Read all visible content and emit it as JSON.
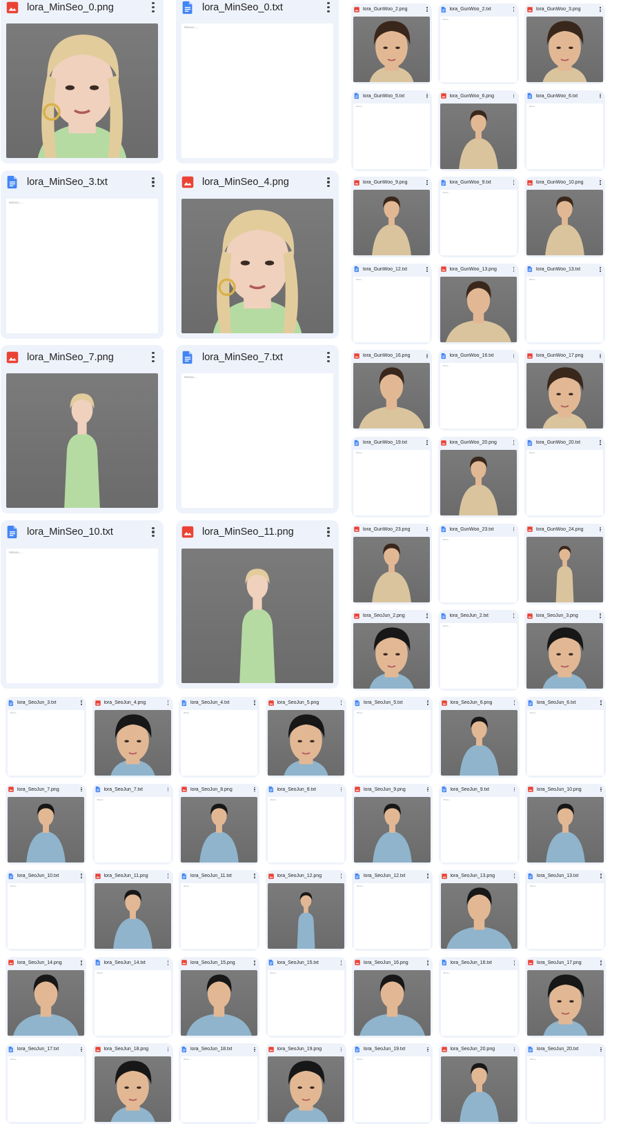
{
  "colors": {
    "image_icon": "#ea4335",
    "doc_icon": "#4285f4",
    "card_bg": "#eef2fa"
  },
  "icons": {
    "image": "image-file-icon",
    "doc": "doc-file-icon",
    "menu": "more-vert-icon"
  },
  "menu_label": "More actions",
  "doc_preview": "Minseo, ...",
  "files_large": [
    {
      "name": "lora_MinSeo_0.png",
      "type": "image",
      "subject": "woman",
      "bg": "gray",
      "crop": "head"
    },
    {
      "name": "lora_MinSeo_0.txt",
      "type": "text"
    },
    {
      "name": "lora_MinSeo_3.txt",
      "type": "text"
    },
    {
      "name": "lora_MinSeo_4.png",
      "type": "image",
      "subject": "woman",
      "bg": "gray",
      "crop": "head"
    },
    {
      "name": "lora_MinSeo_7.png",
      "type": "image",
      "subject": "woman",
      "bg": "gray",
      "crop": "body"
    },
    {
      "name": "lora_MinSeo_7.txt",
      "type": "text"
    },
    {
      "name": "lora_MinSeo_10.txt",
      "type": "text"
    },
    {
      "name": "lora_MinSeo_11.png",
      "type": "image",
      "subject": "woman",
      "bg": "gray",
      "crop": "body"
    }
  ],
  "files_right": [
    {
      "name": "lora_GunWoo_2.png",
      "type": "image",
      "subject": "gunwoo",
      "bg": "gray",
      "crop": "head"
    },
    {
      "name": "lora_GunWoo_2.txt",
      "type": "text"
    },
    {
      "name": "lora_GunWoo_3.png",
      "type": "image",
      "subject": "gunwoo",
      "bg": "gray",
      "crop": "head"
    },
    {
      "name": "lora_GunWoo_5.txt",
      "type": "text"
    },
    {
      "name": "lora_GunWoo_6.png",
      "type": "image",
      "subject": "gunwoo",
      "bg": "gray",
      "crop": "torso"
    },
    {
      "name": "lora_GunWoo_6.txt",
      "type": "text"
    },
    {
      "name": "lora_GunWoo_9.png",
      "type": "image",
      "subject": "gunwoo",
      "bg": "gray",
      "crop": "torso"
    },
    {
      "name": "lora_GunWoo_9.txt",
      "type": "text"
    },
    {
      "name": "lora_GunWoo_10.png",
      "type": "image",
      "subject": "gunwoo",
      "bg": "gray",
      "crop": "torso"
    },
    {
      "name": "lora_GunWoo_12.txt",
      "type": "text"
    },
    {
      "name": "lora_GunWoo_13.png",
      "type": "image",
      "subject": "gunwoo",
      "bg": "gray",
      "crop": "bust"
    },
    {
      "name": "lora_GunWoo_13.txt",
      "type": "text"
    },
    {
      "name": "lora_GunWoo_16.png",
      "type": "image",
      "subject": "gunwoo",
      "bg": "gray",
      "crop": "bust"
    },
    {
      "name": "lora_GunWoo_16.txt",
      "type": "text"
    },
    {
      "name": "lora_GunWoo_17.png",
      "type": "image",
      "subject": "gunwoo",
      "bg": "red",
      "crop": "head"
    },
    {
      "name": "lora_GunWoo_19.txt",
      "type": "text"
    },
    {
      "name": "lora_GunWoo_20.png",
      "type": "image",
      "subject": "gunwoo",
      "bg": "red",
      "crop": "torso"
    },
    {
      "name": "lora_GunWoo_20.txt",
      "type": "text"
    },
    {
      "name": "lora_GunWoo_23.png",
      "type": "image",
      "subject": "gunwoo",
      "bg": "red",
      "crop": "torso"
    },
    {
      "name": "lora_GunWoo_23.txt",
      "type": "text"
    },
    {
      "name": "lora_GunWoo_24.png",
      "type": "image",
      "subject": "gunwoo",
      "bg": "red",
      "crop": "full"
    },
    {
      "name": "lora_SeoJun_2.png",
      "type": "image",
      "subject": "seojun",
      "bg": "gray",
      "crop": "head"
    },
    {
      "name": "lora_SeoJun_2.txt",
      "type": "text"
    },
    {
      "name": "lora_SeoJun_3.png",
      "type": "image",
      "subject": "seojun",
      "bg": "gray",
      "crop": "head"
    }
  ],
  "files_bottom": [
    {
      "name": "lora_SeoJun_3.txt",
      "type": "text"
    },
    {
      "name": "lora_SeoJun_4.png",
      "type": "image",
      "subject": "seojun",
      "bg": "gray",
      "crop": "head"
    },
    {
      "name": "lora_SeoJun_4.txt",
      "type": "text"
    },
    {
      "name": "lora_SeoJun_5.png",
      "type": "image",
      "subject": "seojun",
      "bg": "gray",
      "crop": "head"
    },
    {
      "name": "lora_SeoJun_5.txt",
      "type": "text"
    },
    {
      "name": "lora_SeoJun_6.png",
      "type": "image",
      "subject": "seojun",
      "bg": "gray",
      "crop": "torso"
    },
    {
      "name": "lora_SeoJun_6.txt",
      "type": "text"
    },
    {
      "name": "lora_SeoJun_7.png",
      "type": "image",
      "subject": "seojun",
      "bg": "gray",
      "crop": "torso"
    },
    {
      "name": "lora_SeoJun_7.txt",
      "type": "text"
    },
    {
      "name": "lora_SeoJun_8.png",
      "type": "image",
      "subject": "seojun",
      "bg": "gray",
      "crop": "torso"
    },
    {
      "name": "lora_SeoJun_8.txt",
      "type": "text"
    },
    {
      "name": "lora_SeoJun_9.png",
      "type": "image",
      "subject": "seojun",
      "bg": "gray",
      "crop": "torso"
    },
    {
      "name": "lora_SeoJun_9.txt",
      "type": "text"
    },
    {
      "name": "lora_SeoJun_10.png",
      "type": "image",
      "subject": "seojun",
      "bg": "gray",
      "crop": "torso"
    },
    {
      "name": "lora_SeoJun_10.txt",
      "type": "text"
    },
    {
      "name": "lora_SeoJun_11.png",
      "type": "image",
      "subject": "seojun",
      "bg": "gray",
      "crop": "torso"
    },
    {
      "name": "lora_SeoJun_11.txt",
      "type": "text"
    },
    {
      "name": "lora_SeoJun_12.png",
      "type": "image",
      "subject": "seojun",
      "bg": "gray",
      "crop": "full"
    },
    {
      "name": "lora_SeoJun_12.txt",
      "type": "text"
    },
    {
      "name": "lora_SeoJun_13.png",
      "type": "image",
      "subject": "seojun",
      "bg": "gray",
      "crop": "bust"
    },
    {
      "name": "lora_SeoJun_13.txt",
      "type": "text"
    },
    {
      "name": "lora_SeoJun_14.png",
      "type": "image",
      "subject": "seojun",
      "bg": "gray",
      "crop": "bust"
    },
    {
      "name": "lora_SeoJun_14.txt",
      "type": "text"
    },
    {
      "name": "lora_SeoJun_15.png",
      "type": "image",
      "subject": "seojun",
      "bg": "gray",
      "crop": "bust"
    },
    {
      "name": "lora_SeoJun_15.txt",
      "type": "text"
    },
    {
      "name": "lora_SeoJun_16.png",
      "type": "image",
      "subject": "seojun",
      "bg": "gray",
      "crop": "bust"
    },
    {
      "name": "lora_SeoJun_16.txt",
      "type": "text"
    },
    {
      "name": "lora_SeoJun_17.png",
      "type": "image",
      "subject": "seojun",
      "bg": "red",
      "crop": "head"
    },
    {
      "name": "lora_SeoJun_17.txt",
      "type": "text"
    },
    {
      "name": "lora_SeoJun_18.png",
      "type": "image",
      "subject": "seojun",
      "bg": "red",
      "crop": "head"
    },
    {
      "name": "lora_SeoJun_18.txt",
      "type": "text"
    },
    {
      "name": "lora_SeoJun_19.png",
      "type": "image",
      "subject": "seojun",
      "bg": "red",
      "crop": "head"
    },
    {
      "name": "lora_SeoJun_19.txt",
      "type": "text"
    },
    {
      "name": "lora_SeoJun_20.png",
      "type": "image",
      "subject": "seojun",
      "bg": "red",
      "crop": "torso"
    },
    {
      "name": "lora_SeoJun_20.txt",
      "type": "text"
    }
  ]
}
